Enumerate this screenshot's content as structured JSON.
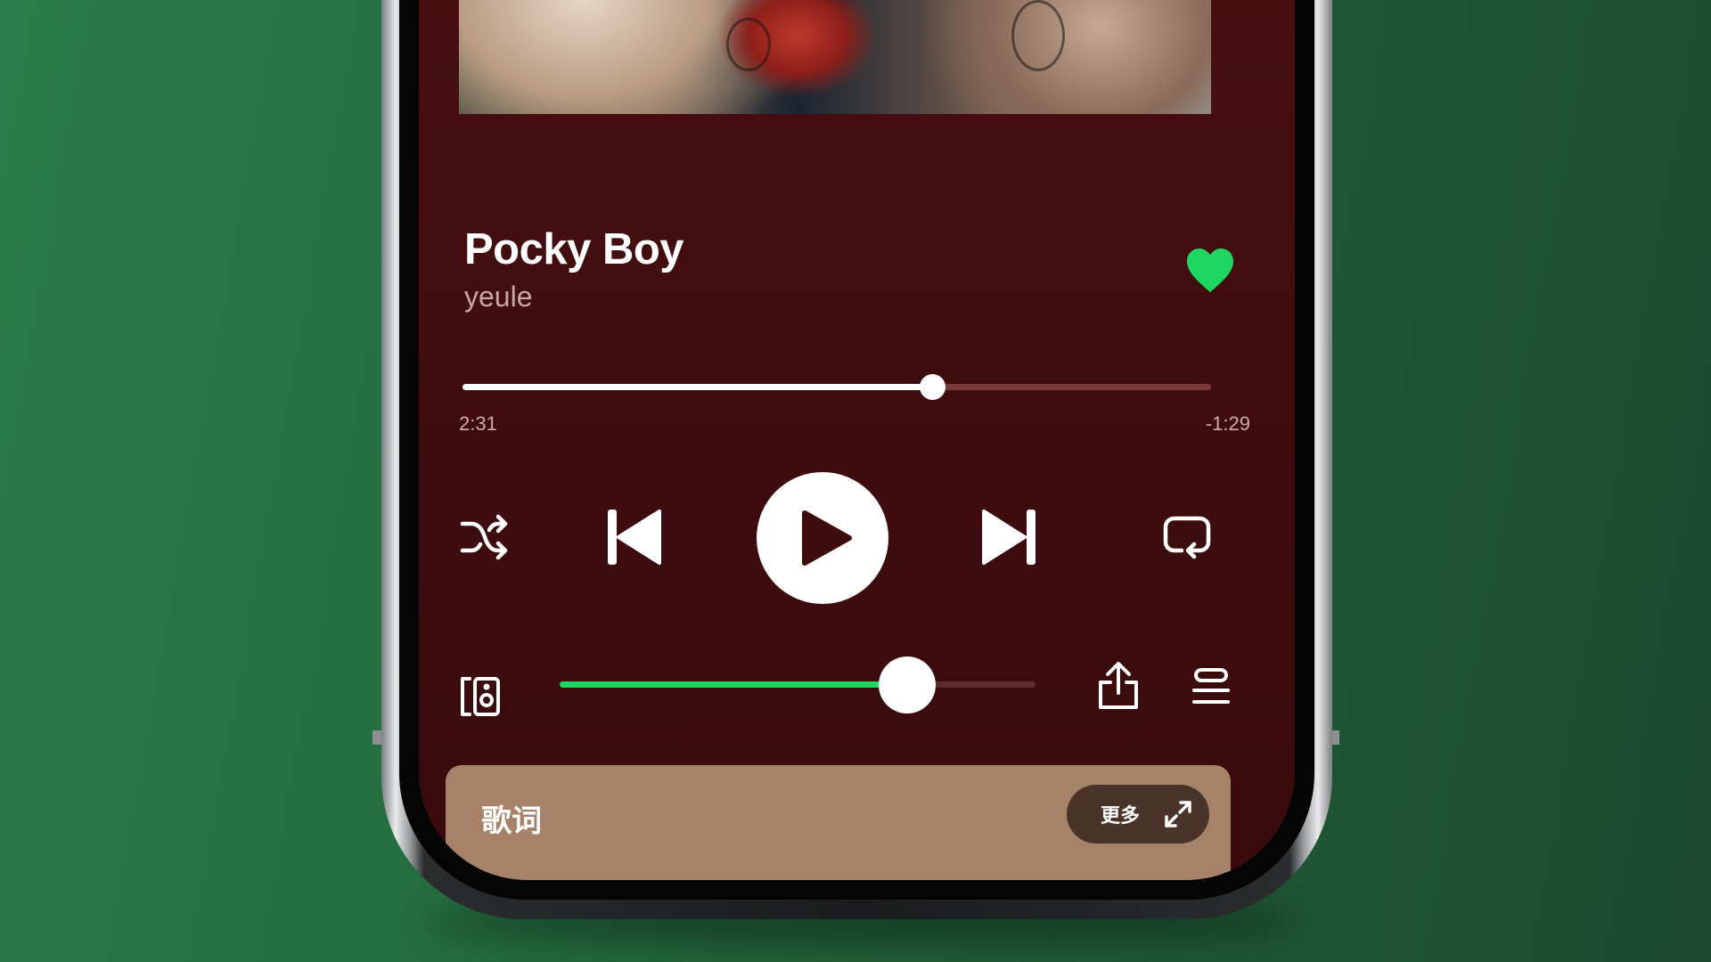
{
  "player": {
    "track_title": "Pocky Boy",
    "artist": "yeule",
    "liked": true,
    "progress": {
      "elapsed": "2:31",
      "remaining": "-1:29",
      "fraction": 0.627
    },
    "volume": {
      "fraction": 0.73
    },
    "controls": {
      "shuffle_icon": "shuffle-icon",
      "previous_icon": "skip-previous-icon",
      "play_icon": "play-icon",
      "next_icon": "skip-next-icon",
      "repeat_icon": "repeat-icon",
      "device_icon": "connect-device-icon",
      "share_icon": "share-icon",
      "queue_icon": "queue-icon"
    }
  },
  "lyrics": {
    "title": "歌词",
    "more_label": "更多",
    "expand_icon": "expand-icon"
  },
  "colors": {
    "background_green": "#247040",
    "screen_background": "#440e10",
    "accent_green": "#1ed760",
    "lyrics_card": "#a68269",
    "more_pill": "#4a3429"
  }
}
